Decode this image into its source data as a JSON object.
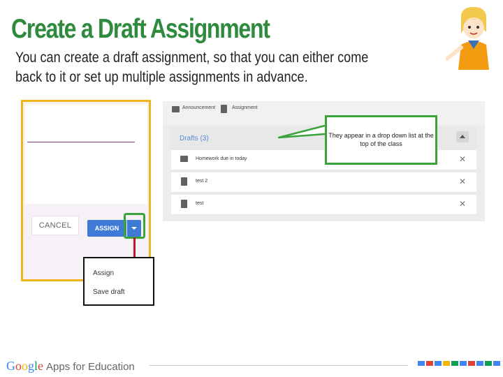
{
  "slide": {
    "title": "Create a Draft Assignment",
    "subtitle": "You can create a draft assignment, so that you can either come back to it or set up multiple assignments in advance."
  },
  "dialog": {
    "cancel_label": "CANCEL",
    "assign_label": "ASSIGN"
  },
  "dropdown_menu": {
    "items": [
      "Assign",
      "Save draft"
    ]
  },
  "drafts_panel": {
    "post_types": [
      {
        "label": "Announcement",
        "icon": "chat-icon"
      },
      {
        "label": "Assignment",
        "icon": "assignment-icon"
      }
    ],
    "drafts_title": "Drafts (3)",
    "drafts": [
      {
        "label": "Homework due in today",
        "icon": "chat-icon"
      },
      {
        "label": "test 2",
        "icon": "assignment-icon"
      },
      {
        "label": "test",
        "icon": "assignment-icon"
      }
    ]
  },
  "callout": {
    "text": "They appear in a drop down list at the top of the class"
  },
  "footer": {
    "brand_google": "Google",
    "brand_rest": "Apps for Education"
  },
  "colors": {
    "title_green": "#2e8b3d",
    "highlight_green": "#3aa33a",
    "arrow_red": "#c0182a",
    "button_blue": "#3f7ad6",
    "dialog_border": "#f0b41e",
    "google_blue": "#4285f4",
    "google_red": "#db4437",
    "google_yellow": "#f4b400",
    "google_green": "#0f9d58"
  }
}
